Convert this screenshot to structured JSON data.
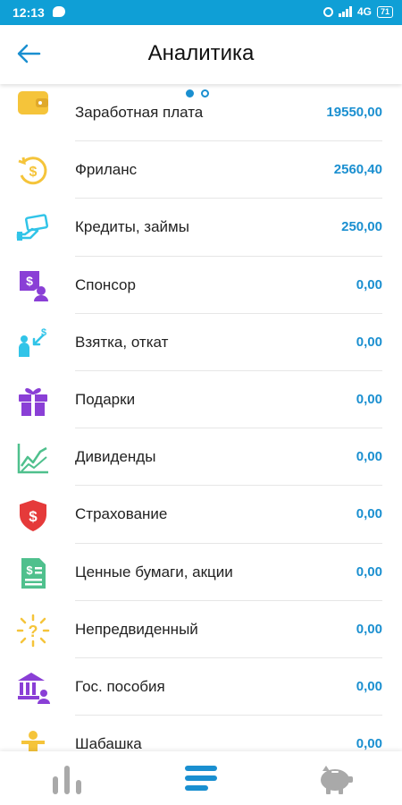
{
  "status_bar": {
    "time": "12:13",
    "network": "4G",
    "battery": "71"
  },
  "header": {
    "title": "Аналитика"
  },
  "pager": {
    "active_page": 1,
    "pages": 2
  },
  "rows": [
    {
      "label": "Заработная плата",
      "amount": "19550,00",
      "icon": "wallet-icon",
      "color": "#f5c43a"
    },
    {
      "label": "Фриланс",
      "amount": "2560,40",
      "icon": "dollar-cycle-icon",
      "color": "#f5c43a"
    },
    {
      "label": "Кредиты, займы",
      "amount": "250,00",
      "icon": "money-hand-icon",
      "color": "#31c4e8"
    },
    {
      "label": "Спонсор",
      "amount": "0,00",
      "icon": "sponsor-icon",
      "color": "#8a3fd6"
    },
    {
      "label": "Взятка, откат",
      "amount": "0,00",
      "icon": "bribe-icon",
      "color": "#31c4e8"
    },
    {
      "label": "Подарки",
      "amount": "0,00",
      "icon": "gift-icon",
      "color": "#8a3fd6"
    },
    {
      "label": "Дивиденды",
      "amount": "0,00",
      "icon": "chart-growth-icon",
      "color": "#4fc08d"
    },
    {
      "label": "Страхование",
      "amount": "0,00",
      "icon": "shield-dollar-icon",
      "color": "#e53a3a"
    },
    {
      "label": "Ценные бумаги, акции",
      "amount": "0,00",
      "icon": "document-dollar-icon",
      "color": "#4fc08d"
    },
    {
      "label": "Непредвиденный",
      "amount": "0,00",
      "icon": "question-burst-icon",
      "color": "#f5c43a"
    },
    {
      "label": "Гос. пособия",
      "amount": "0,00",
      "icon": "bank-icon",
      "color": "#8a3fd6"
    },
    {
      "label": "Шабашка",
      "amount": "0,00",
      "icon": "worker-icon",
      "color": "#f5c43a"
    }
  ],
  "bottom_nav": {
    "tabs": [
      {
        "icon": "bar-chart-icon",
        "color": "#a9a9a9"
      },
      {
        "icon": "list-icon",
        "color": "#1a8fd0"
      },
      {
        "icon": "piggy-bank-icon",
        "color": "#a9a9a9"
      }
    ]
  }
}
